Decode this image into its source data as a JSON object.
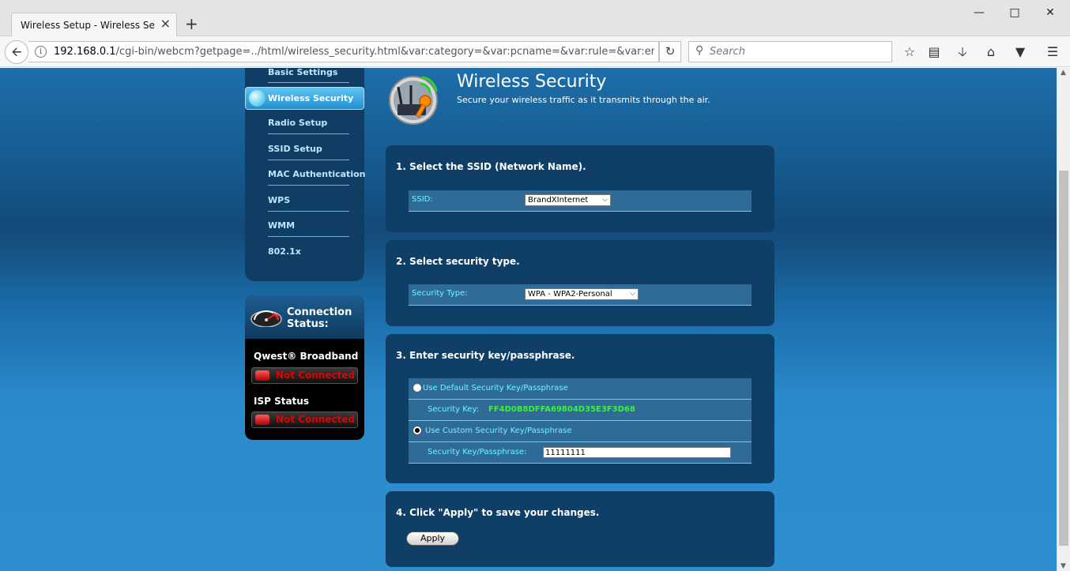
{
  "browser": {
    "tab_title": "Wireless Setup - Wireless Secu",
    "url_host": "192.168.0.1",
    "url_path": "/cgi-bin/webcm?getpage=../html/wireless_security.html&var:category=&var:pcname=&var:rule=&var:errorfc",
    "search_placeholder": "Search",
    "new_tab_label": "+",
    "close_tab_label": "×"
  },
  "menu": {
    "items": [
      {
        "label": "Basic Settings"
      },
      {
        "label": "Wireless Security"
      },
      {
        "label": "Radio Setup"
      },
      {
        "label": "SSID Setup"
      },
      {
        "label": "MAC Authentication"
      },
      {
        "label": "WPS"
      },
      {
        "label": "WMM"
      },
      {
        "label": "802.1x"
      }
    ],
    "active_label": "Wireless Security"
  },
  "connection": {
    "title_line1": "Connection",
    "title_line2": "Status:",
    "broadband_label": "Qwest® Broadband",
    "broadband_status": "Not Connected",
    "isp_label": "ISP Status",
    "isp_status": "Not Connected"
  },
  "header": {
    "title": "Wireless Security",
    "subtitle": "Secure your wireless traffic as it transmits through the air."
  },
  "section1": {
    "title": "1. Select the SSID (Network Name).",
    "ssid_label": "SSID:",
    "ssid_value": "BrandXInternet"
  },
  "section2": {
    "title": "2. Select security type.",
    "type_label": "Security Type:",
    "type_value": "WPA - WPA2-Personal"
  },
  "section3": {
    "title": "3. Enter security key/passphrase.",
    "default_option": "Use Default Security Key/Passphrase",
    "key_label": "Security Key:",
    "key_value": "FF4D0B8DFFA69804D35E3F3D68",
    "custom_option": "Use Custom Security Key/Passphrase",
    "pass_label": "Security Key/Passphrase:",
    "pass_value": "11111111"
  },
  "section4": {
    "title": "4. Click \"Apply\" to save your changes.",
    "apply_label": "Apply"
  },
  "colors": {
    "panel": "#0f3e66",
    "field_row": "#2f6b97",
    "field_label": "#6ff4ff",
    "key_green": "#3cf03c",
    "status_red": "#e00000"
  }
}
